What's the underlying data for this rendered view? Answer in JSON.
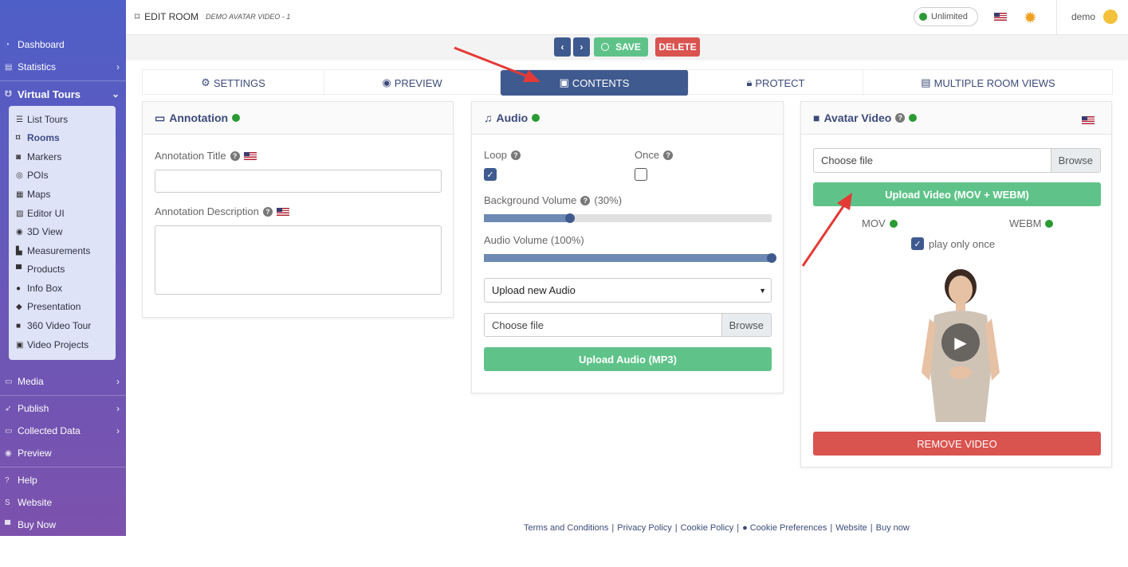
{
  "sidebar": {
    "items": [
      {
        "label": "Dashboard",
        "icon": "dashboard-icon"
      },
      {
        "label": "Statistics",
        "icon": "chart-icon"
      },
      {
        "label": "Virtual Tours",
        "icon": "tour-icon"
      },
      {
        "label": "Media",
        "icon": "media-icon"
      },
      {
        "label": "Publish",
        "icon": "publish-icon"
      },
      {
        "label": "Collected Data",
        "icon": "database-icon"
      },
      {
        "label": "Preview",
        "icon": "eye-icon"
      },
      {
        "label": "Help",
        "icon": "help-icon"
      },
      {
        "label": "Website",
        "icon": "website-icon"
      },
      {
        "label": "Buy Now",
        "icon": "cart-icon"
      }
    ],
    "submenu": [
      "List Tours",
      "Rooms",
      "Markers",
      "POIs",
      "Maps",
      "Editor UI",
      "3D View",
      "Measurements",
      "Products",
      "Info Box",
      "Presentation",
      "360 Video Tour",
      "Video Projects"
    ]
  },
  "header": {
    "title": "EDIT ROOM",
    "subtitle": "DEMO AVATAR VIDEO - 1",
    "plan": "Unlimited",
    "user": "demo"
  },
  "toolbar": {
    "save": "SAVE",
    "delete": "DELETE"
  },
  "tabs": [
    "SETTINGS",
    "PREVIEW",
    "CONTENTS",
    "PROTECT",
    "MULTIPLE ROOM VIEWS"
  ],
  "annotation": {
    "title": "Annotation",
    "title_label": "Annotation Title",
    "desc_label": "Annotation Description"
  },
  "audio": {
    "title": "Audio",
    "loop": "Loop",
    "once": "Once",
    "bg_volume": "Background Volume",
    "bg_volume_pct": "(30%)",
    "bg_volume_value": 0.3,
    "audio_volume": "Audio Volume (100%)",
    "audio_volume_value": 1.0,
    "select": "Upload new Audio",
    "choose": "Choose file",
    "browse": "Browse",
    "upload": "Upload Audio (MP3)"
  },
  "avatar": {
    "title": "Avatar Video",
    "choose": "Choose file",
    "browse": "Browse",
    "upload": "Upload Video (MOV + WEBM)",
    "mov": "MOV",
    "webm": "WEBM",
    "play_once": "play only once",
    "remove": "REMOVE VIDEO"
  },
  "footer": [
    "Terms and Conditions",
    "Privacy Policy",
    "Cookie Policy",
    "Cookie Preferences",
    "Website",
    "Buy now"
  ],
  "colors": {
    "accent": "#3f5a8f",
    "green": "#5fc389",
    "red": "#d9534f"
  }
}
